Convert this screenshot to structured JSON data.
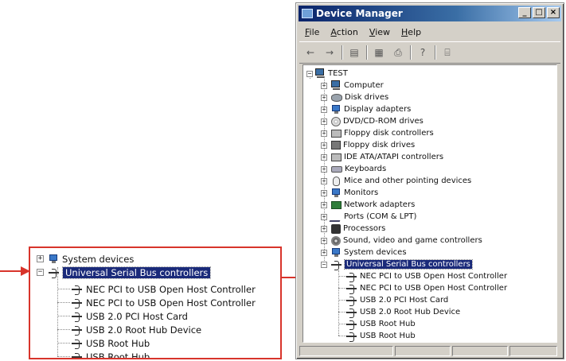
{
  "zoomed_tree": {
    "system_devices": "System devices",
    "usb_controllers": "Universal Serial Bus controllers",
    "children": [
      "NEC PCI to USB Open Host Controller",
      "NEC PCI to USB Open Host Controller",
      "USB 2.0 PCI Host Card",
      "USB 2.0 Root Hub Device",
      "USB Root Hub",
      "USB Root Hub"
    ]
  },
  "window": {
    "title": "Device Manager",
    "minimize_glyph": "_",
    "maximize_glyph": "□",
    "close_glyph": "×",
    "menu": [
      "File",
      "Action",
      "View",
      "Help"
    ],
    "toolbar_glyphs": {
      "back": "←",
      "forward": "→",
      "view": "▤",
      "properties": "▦",
      "print": "⎙",
      "help": "?",
      "scan": "⌸"
    }
  },
  "tree": {
    "root": "TEST",
    "categories": [
      {
        "label": "Computer",
        "icon": "computer-icon"
      },
      {
        "label": "Disk drives",
        "icon": "disk-drive-icon"
      },
      {
        "label": "Display adapters",
        "icon": "display-adapter-icon"
      },
      {
        "label": "DVD/CD-ROM drives",
        "icon": "cd-drive-icon"
      },
      {
        "label": "Floppy disk controllers",
        "icon": "floppy-controller-icon"
      },
      {
        "label": "Floppy disk drives",
        "icon": "floppy-drive-icon"
      },
      {
        "label": "IDE ATA/ATAPI controllers",
        "icon": "ide-controller-icon"
      },
      {
        "label": "Keyboards",
        "icon": "keyboard-icon"
      },
      {
        "label": "Mice and other pointing devices",
        "icon": "mouse-icon"
      },
      {
        "label": "Monitors",
        "icon": "monitor-icon"
      },
      {
        "label": "Network adapters",
        "icon": "network-adapter-icon"
      },
      {
        "label": "Ports (COM & LPT)",
        "icon": "port-icon"
      },
      {
        "label": "Processors",
        "icon": "processor-icon"
      },
      {
        "label": "Sound, video and game controllers",
        "icon": "sound-icon"
      },
      {
        "label": "System devices",
        "icon": "system-devices-icon"
      },
      {
        "label": "Universal Serial Bus controllers",
        "icon": "usb-icon"
      }
    ],
    "usb_children": [
      "NEC PCI to USB Open Host Controller",
      "NEC PCI to USB Open Host Controller",
      "USB 2.0 PCI Host Card",
      "USB 2.0 Root Hub Device",
      "USB Root Hub",
      "USB Root Hub"
    ],
    "collapsed_glyph": "+",
    "expanded_glyph": "−"
  },
  "colors": {
    "highlight_border": "#d8342b",
    "selection": "#1a2a7a",
    "title_start": "#0a246a",
    "title_end": "#a6caf0"
  }
}
